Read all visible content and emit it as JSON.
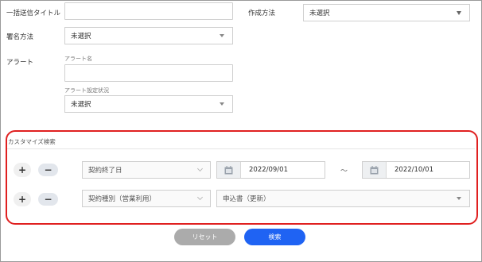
{
  "form": {
    "bulk_title_label": "一括送信タイトル",
    "bulk_title_value": "",
    "creation_method_label": "作成方法",
    "creation_method_value": "未選択",
    "signature_method_label": "署名方法",
    "signature_method_value": "未選択",
    "alert_label": "アラート",
    "alert_name_label": "アラート名",
    "alert_name_value": "",
    "alert_setting_label": "アラート設定状況",
    "alert_setting_value": "未選択"
  },
  "custom_search": {
    "title": "カスタマイズ検索",
    "rows": [
      {
        "plus": "+",
        "minus": "−",
        "field": "契約終了日",
        "date_from": "2022/09/01",
        "separator": "～",
        "date_to": "2022/10/01"
      },
      {
        "plus": "+",
        "minus": "−",
        "field": "契約種別（営業利用）",
        "value": "申込書（更新）"
      }
    ]
  },
  "actions": {
    "reset_label": "リセット",
    "search_label": "検索"
  },
  "colors": {
    "highlight": "#e02020",
    "primary": "#1f63f3",
    "reset": "#ababab"
  }
}
